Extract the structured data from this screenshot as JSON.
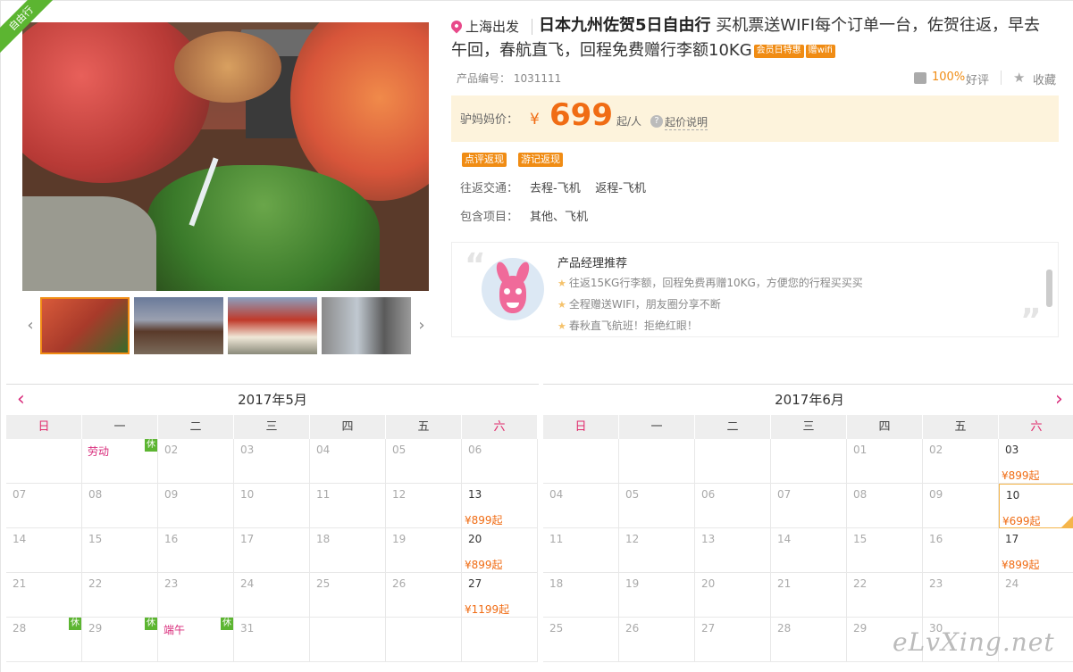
{
  "ribbon": "自由行",
  "header": {
    "departure": "上海出发",
    "title_main": "日本九州佐贺5日自由行",
    "title_sub": "买机票送WIFI每个订单一台，佐贺往返，早去午回，春航直飞，回程免费赠行李额10KG",
    "tag_member": "会员日特惠",
    "tag_wifi": "赠wifi",
    "product_code": "产品编号：  1031111",
    "good_rate": "100%",
    "good_label": "好评",
    "favorite_label": "收藏"
  },
  "price": {
    "label": "驴妈妈价：",
    "currency": "¥",
    "amount": "699",
    "unit": "起/人",
    "explain": "起价说明",
    "help_icon": "?"
  },
  "rebates": [
    "点评返现",
    "游记返现"
  ],
  "info": {
    "transport_label": "往返交通：",
    "transport_value": "去程-飞机    返程-飞机",
    "includes_label": "包含项目：",
    "includes_value": "其他、飞机"
  },
  "manager": {
    "title": "产品经理推荐",
    "items": [
      "往返15KG行李额，回程免费再赠10KG，方便您的行程买买买",
      "全程赠送WIFI，朋友圈分享不断",
      "春秋直飞航班！拒绝红眼！"
    ]
  },
  "weekdays": [
    "日",
    "一",
    "二",
    "三",
    "四",
    "五",
    "六"
  ],
  "calendars": [
    {
      "title": "2017年5月",
      "rows": [
        [
          {
            "d": ""
          },
          {
            "d": "劳动",
            "hol": true,
            "rest": "休"
          },
          {
            "d": "02"
          },
          {
            "d": "03"
          },
          {
            "d": "04"
          },
          {
            "d": "05"
          },
          {
            "d": "06"
          }
        ],
        [
          {
            "d": "07"
          },
          {
            "d": "08"
          },
          {
            "d": "09"
          },
          {
            "d": "10"
          },
          {
            "d": "11"
          },
          {
            "d": "12"
          },
          {
            "d": "13",
            "p": "¥899起"
          }
        ],
        [
          {
            "d": "14"
          },
          {
            "d": "15"
          },
          {
            "d": "16"
          },
          {
            "d": "17"
          },
          {
            "d": "18"
          },
          {
            "d": "19"
          },
          {
            "d": "20",
            "p": "¥899起"
          }
        ],
        [
          {
            "d": "21"
          },
          {
            "d": "22"
          },
          {
            "d": "23"
          },
          {
            "d": "24"
          },
          {
            "d": "25"
          },
          {
            "d": "26"
          },
          {
            "d": "27",
            "p": "¥1199起"
          }
        ],
        [
          {
            "d": "28",
            "rest": "休"
          },
          {
            "d": "29",
            "rest": "休"
          },
          {
            "d": "端午",
            "hol": true,
            "rest": "休"
          },
          {
            "d": "31"
          },
          {
            "d": ""
          },
          {
            "d": ""
          },
          {
            "d": ""
          }
        ]
      ]
    },
    {
      "title": "2017年6月",
      "rows": [
        [
          {
            "d": ""
          },
          {
            "d": ""
          },
          {
            "d": ""
          },
          {
            "d": ""
          },
          {
            "d": "01"
          },
          {
            "d": "02"
          },
          {
            "d": "03",
            "p": "¥899起"
          }
        ],
        [
          {
            "d": "04"
          },
          {
            "d": "05"
          },
          {
            "d": "06"
          },
          {
            "d": "07"
          },
          {
            "d": "08"
          },
          {
            "d": "09"
          },
          {
            "d": "10",
            "p": "¥699起",
            "sel": true
          }
        ],
        [
          {
            "d": "11"
          },
          {
            "d": "12"
          },
          {
            "d": "13"
          },
          {
            "d": "14"
          },
          {
            "d": "15"
          },
          {
            "d": "16"
          },
          {
            "d": "17",
            "p": "¥899起"
          }
        ],
        [
          {
            "d": "18"
          },
          {
            "d": "19"
          },
          {
            "d": "20"
          },
          {
            "d": "21"
          },
          {
            "d": "22"
          },
          {
            "d": "23"
          },
          {
            "d": "24"
          }
        ],
        [
          {
            "d": "25"
          },
          {
            "d": "26"
          },
          {
            "d": "27"
          },
          {
            "d": "28"
          },
          {
            "d": "29"
          },
          {
            "d": "30"
          },
          {
            "d": ""
          }
        ]
      ]
    }
  ],
  "nav": {
    "prev": "‹",
    "next": "›",
    "cal_prev": "‹",
    "cal_next": "›"
  },
  "watermark": "eLvXing.net",
  "colors": {
    "accent": "#f06c14",
    "brand_pink": "#d82a7a",
    "rest_green": "#5cb531",
    "price_bg": "#fdf3dc"
  }
}
